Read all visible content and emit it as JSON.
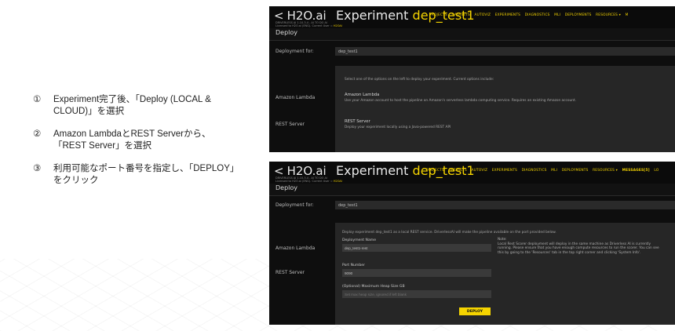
{
  "steps": [
    {
      "num": "①",
      "text": "Experiment完了後、「Deploy (LOCAL & CLOUD)」を選択"
    },
    {
      "num": "②",
      "text": "Amazon LambdaとREST Serverから、「REST Server」を選択"
    },
    {
      "num": "③",
      "text": "利用可能なポート番号を指定し、「DEPLOY」をクリック"
    }
  ],
  "app": {
    "logo": "H2O.ai",
    "experiment_label": "Experiment",
    "experiment_name": "dep_test1",
    "version": "DRIVERLESS AI 1.10.3.4 - AI TO DO AI",
    "license": "Licensed to H2O.ai (ENG). Current User =",
    "user": "H2OAI",
    "nav": [
      "PROJECTS",
      "DATASETS",
      "AUTOVIZ",
      "EXPERIMENTS",
      "DIAGNOSTICS",
      "MLI",
      "DEPLOYMENTS",
      "RESOURCES ▾"
    ],
    "nav_p1_tail": "M",
    "nav_p2_tail": [
      "MESSAGES[5]",
      "LO"
    ]
  },
  "deploy": {
    "section_title": "Deploy",
    "deployment_for_label": "Deployment for:",
    "deployment_for_value": "dep_test1",
    "amazon_lambda_label": "Amazon Lambda",
    "rest_server_label": "REST Server",
    "select_prompt": "Select one of the options on the left to deploy your experiment. Current options include:",
    "amazon_title": "Amazon Lambda",
    "amazon_desc": "Use your Amazon account to host the pipeline on Amazon's serverless lambda computing service. Requires an existing Amazon account.",
    "rest_title": "REST Server",
    "rest_desc": "Deploy your experiment locally using a Java-powered REST API"
  },
  "rest_form": {
    "intro": "Deploy experiment dep_test1 as a local REST service. DriverlessAI will make the pipeline available on the port provided below.",
    "deployment_name_label": "Deployment Name",
    "deployment_name_value": "dep_test1-rest",
    "port_label": "Port Number",
    "port_value": "9090",
    "heap_label": "(Optional) Maximum Heap Size GB",
    "heap_placeholder": "Set max heap size, ignored if left blank",
    "note_title": "Note:",
    "note_text": "Local Rest Scorer deployment will deploy in the same machine as Driverless AI is currently running. Please ensure that you have enough compute resources to run the scorer. You can see this by going to the 'Resources' tab in the top right corner and clicking 'System Info'.",
    "deploy_button": "DEPLOY"
  }
}
